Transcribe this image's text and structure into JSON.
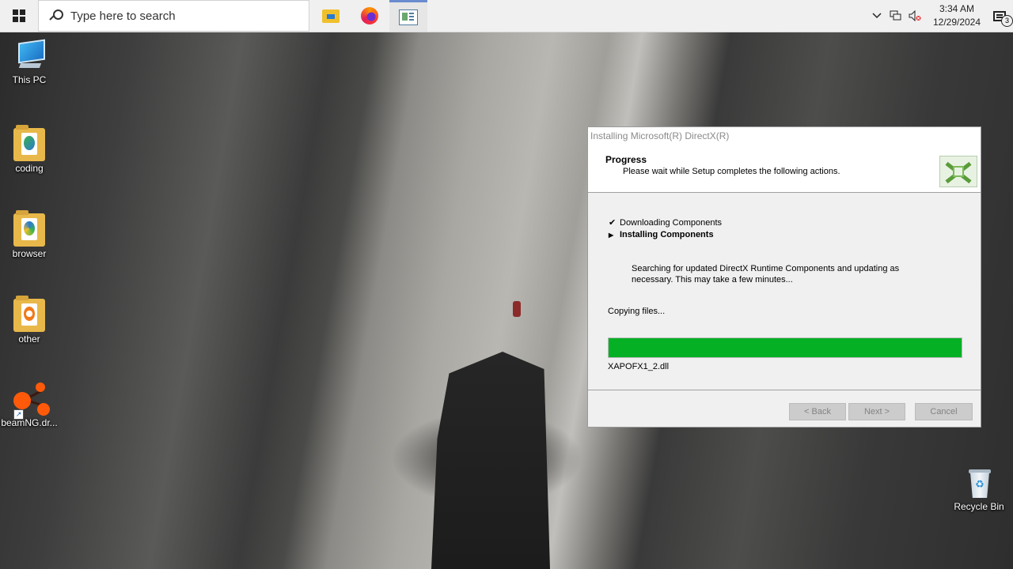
{
  "taskbar": {
    "search_placeholder": "Type here to search",
    "pinned_apps": [
      "file-explorer",
      "firefox",
      "directx-setup"
    ],
    "clock": {
      "time": "3:34 AM",
      "date": "12/29/2024"
    },
    "notification_count": "3"
  },
  "desktop": {
    "icons": [
      {
        "label": "This PC",
        "icon": "computer-icon"
      },
      {
        "label": "coding",
        "icon": "folder-icon"
      },
      {
        "label": "browser",
        "icon": "folder-icon"
      },
      {
        "label": "other",
        "icon": "folder-icon"
      },
      {
        "label": "beamNG.dr...",
        "icon": "beamng-icon"
      },
      {
        "label": "Recycle Bin",
        "icon": "recycle-bin-icon"
      }
    ]
  },
  "dialog": {
    "title": "Installing Microsoft(R) DirectX(R)",
    "header_title": "Progress",
    "header_subtitle": "Please wait while Setup completes the following actions.",
    "steps": [
      {
        "label": "Downloading Components",
        "state": "done",
        "marker": "✔"
      },
      {
        "label": "Installing Components",
        "state": "current",
        "marker": "▶"
      }
    ],
    "description": "Searching for updated DirectX Runtime Components and updating as necessary. This may take a few minutes...",
    "status": "Copying files...",
    "progress_percent": 100,
    "progress_color": "#06b025",
    "current_file": "XAPOFX1_2.dll",
    "buttons": {
      "back": "< Back",
      "next": "Next >",
      "cancel": "Cancel"
    }
  }
}
